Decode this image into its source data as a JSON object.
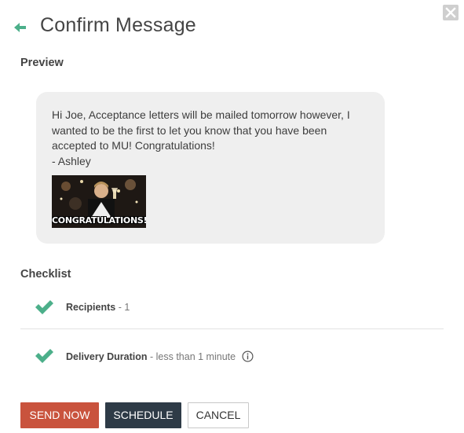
{
  "dialog": {
    "title": "Confirm Message",
    "accent_color": "#4caf8a"
  },
  "preview": {
    "heading": "Preview",
    "message_lines": [
      "Hi Joe, Acceptance letters will be mailed tomorrow however, I",
      "wanted to be the first to let you know that you have been",
      "accepted to MU! Congratulations!",
      "- Ashley"
    ],
    "gif_caption": "CONGRATULATIONS!"
  },
  "checklist": {
    "heading": "Checklist",
    "items": [
      {
        "label": "Recipients",
        "detail": " - 1"
      },
      {
        "label": "Delivery Duration",
        "detail": " - less than 1 minute"
      }
    ]
  },
  "actions": {
    "send_now": "SEND NOW",
    "schedule": "SCHEDULE",
    "cancel": "CANCEL",
    "send_color": "#c9533d",
    "schedule_color": "#2e3b47"
  },
  "icons": {
    "close": "close-icon",
    "back": "back-arrow-icon",
    "check": "checkmark-icon",
    "info": "info-icon"
  }
}
